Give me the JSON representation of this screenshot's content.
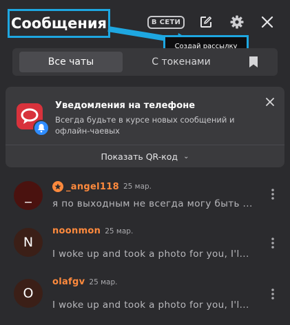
{
  "header": {
    "title": "Сообщения",
    "status_badge": "В СЕТИ",
    "tooltip": "Создай рассылку",
    "icons": [
      "edit-icon",
      "gear-icon",
      "close-icon"
    ]
  },
  "tabs": {
    "all_chats": "Все чаты",
    "with_tokens": "С токенами",
    "bookmark_icon": "bookmark-icon"
  },
  "notification": {
    "title": "Уведомления на телефоне",
    "text": "Всегда будьте в курсе новых сообщений и офлайн-чаевых",
    "qr_button": "Показать QR-код",
    "qr_chevron": "⌄"
  },
  "chats": [
    {
      "avatar_letter": "_",
      "name": "_angel118",
      "date": "25 мар.",
      "message": "я по выходным не всегда могу быть ..."
    },
    {
      "avatar_letter": "N",
      "name": "noonmon",
      "date": "25 мар.",
      "message": "I woke up and took a photo for you, I'l..."
    },
    {
      "avatar_letter": "O",
      "name": "olafgv",
      "date": "25 мар.",
      "message": "I woke up and took a photo for you, I'l..."
    }
  ],
  "colors": {
    "background": "#2b2b2e",
    "accent_highlight": "#1ea7e1",
    "username": "#ff8a3d",
    "notification_icon_red": "#d8323c",
    "notification_icon_blue": "#2e8cff"
  }
}
